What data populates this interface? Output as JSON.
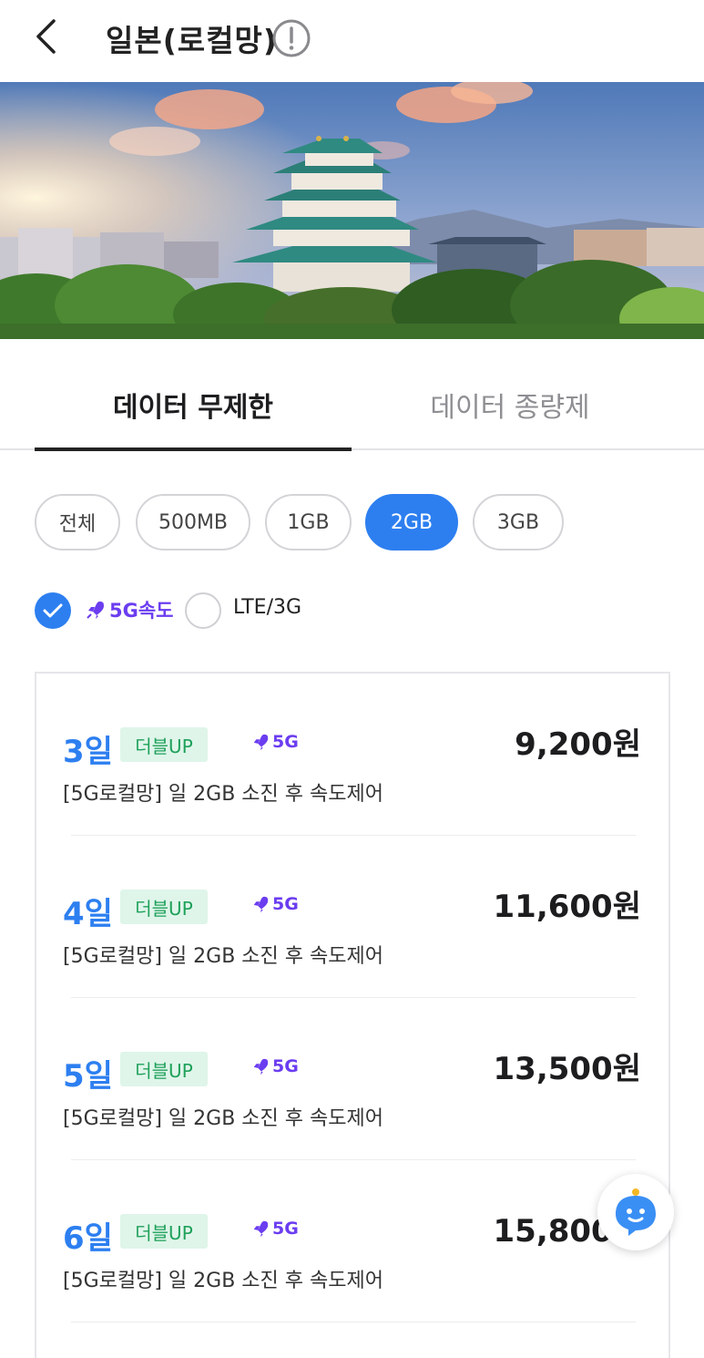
{
  "header": {
    "title": "일본(로컬망)",
    "back_icon": "chevron-left-icon",
    "info_icon": "exclamation-circle-icon"
  },
  "hero": {
    "description_icon": "castle-photo"
  },
  "tabs": [
    {
      "label": "데이터 무제한",
      "active": true
    },
    {
      "label": "데이터 종량제",
      "active": false
    }
  ],
  "chips": [
    {
      "label": "전체",
      "active": false
    },
    {
      "label": "500MB",
      "active": false
    },
    {
      "label": "1GB",
      "active": false
    },
    {
      "label": "2GB",
      "active": true
    },
    {
      "label": "3GB",
      "active": false
    }
  ],
  "network": {
    "fiveg_label": "5G속도",
    "fiveg_checked": true,
    "lte_label": "LTE/3G",
    "lte_checked": false
  },
  "products": [
    {
      "days": "3일",
      "badge": "더블UP",
      "tag": "5G",
      "price": "9,200원",
      "desc": "[5G로컬망] 일 2GB 소진 후 속도제어"
    },
    {
      "days": "4일",
      "badge": "더블UP",
      "tag": "5G",
      "price": "11,600원",
      "desc": "[5G로컬망] 일 2GB 소진 후 속도제어"
    },
    {
      "days": "5일",
      "badge": "더블UP",
      "tag": "5G",
      "price": "13,500원",
      "desc": "[5G로컬망] 일 2GB 소진 후 속도제어"
    },
    {
      "days": "6일",
      "badge": "더블UP",
      "tag": "5G",
      "price": "15,800원",
      "desc": "[5G로컬망] 일 2GB 소진 후 속도제어"
    }
  ],
  "colors": {
    "accent": "#2d7ff0",
    "fiveg": "#6b3df0",
    "badge_bg": "#dff5ea",
    "badge_text": "#1ea15a"
  }
}
